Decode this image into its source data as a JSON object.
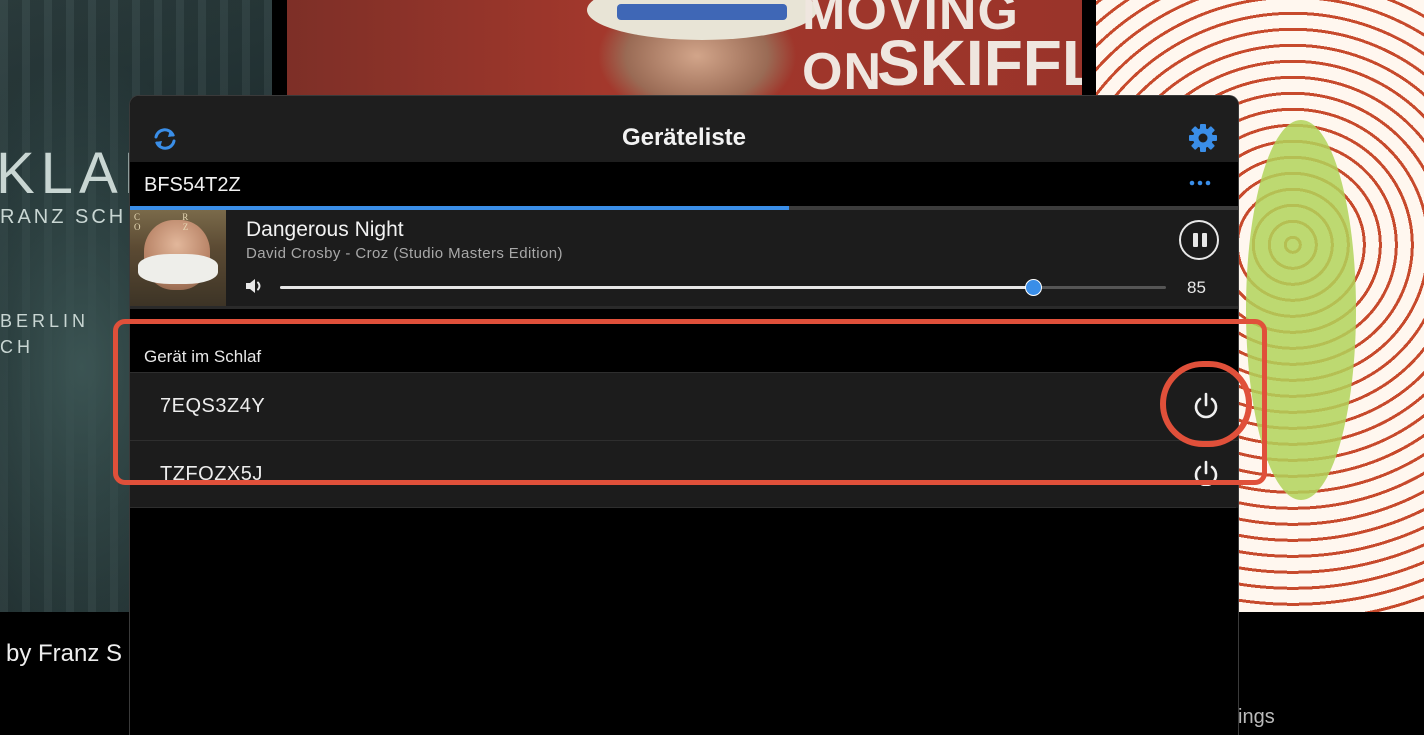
{
  "background": {
    "left_album_text": "KLAN",
    "left_album_artist": "RANZ SCH",
    "left_album_sub": [
      "BERLIN",
      "CH"
    ],
    "left_caption": "by Franz S",
    "mid_album_line1": "MOVING ON",
    "mid_album_line2": "SKIFFLE",
    "right_caption": "ings"
  },
  "panel": {
    "title": "Geräteliste",
    "refresh_icon": "refresh-icon",
    "settings_icon": "gear-icon"
  },
  "active_device": {
    "name": "BFS54T2Z",
    "more_icon": "more-icon",
    "progress_fraction": 0.595
  },
  "now_playing": {
    "cover_letters": "C R O Z",
    "title": "Dangerous Night",
    "subtitle": "David Crosby - Croz (Studio Masters Edition)",
    "control": "pause",
    "volume": 85,
    "volume_max": 100
  },
  "sleeping_devices": {
    "label": "Gerät im Schlaf",
    "items": [
      {
        "name": "7EQS3Z4Y",
        "action_icon": "power-icon"
      },
      {
        "name": "TZFQZX5J",
        "action_icon": "power-icon"
      }
    ]
  },
  "colors": {
    "accent": "#3a8ee8",
    "annotation": "#e0503a",
    "panel_bg": "#1e1e1e"
  }
}
